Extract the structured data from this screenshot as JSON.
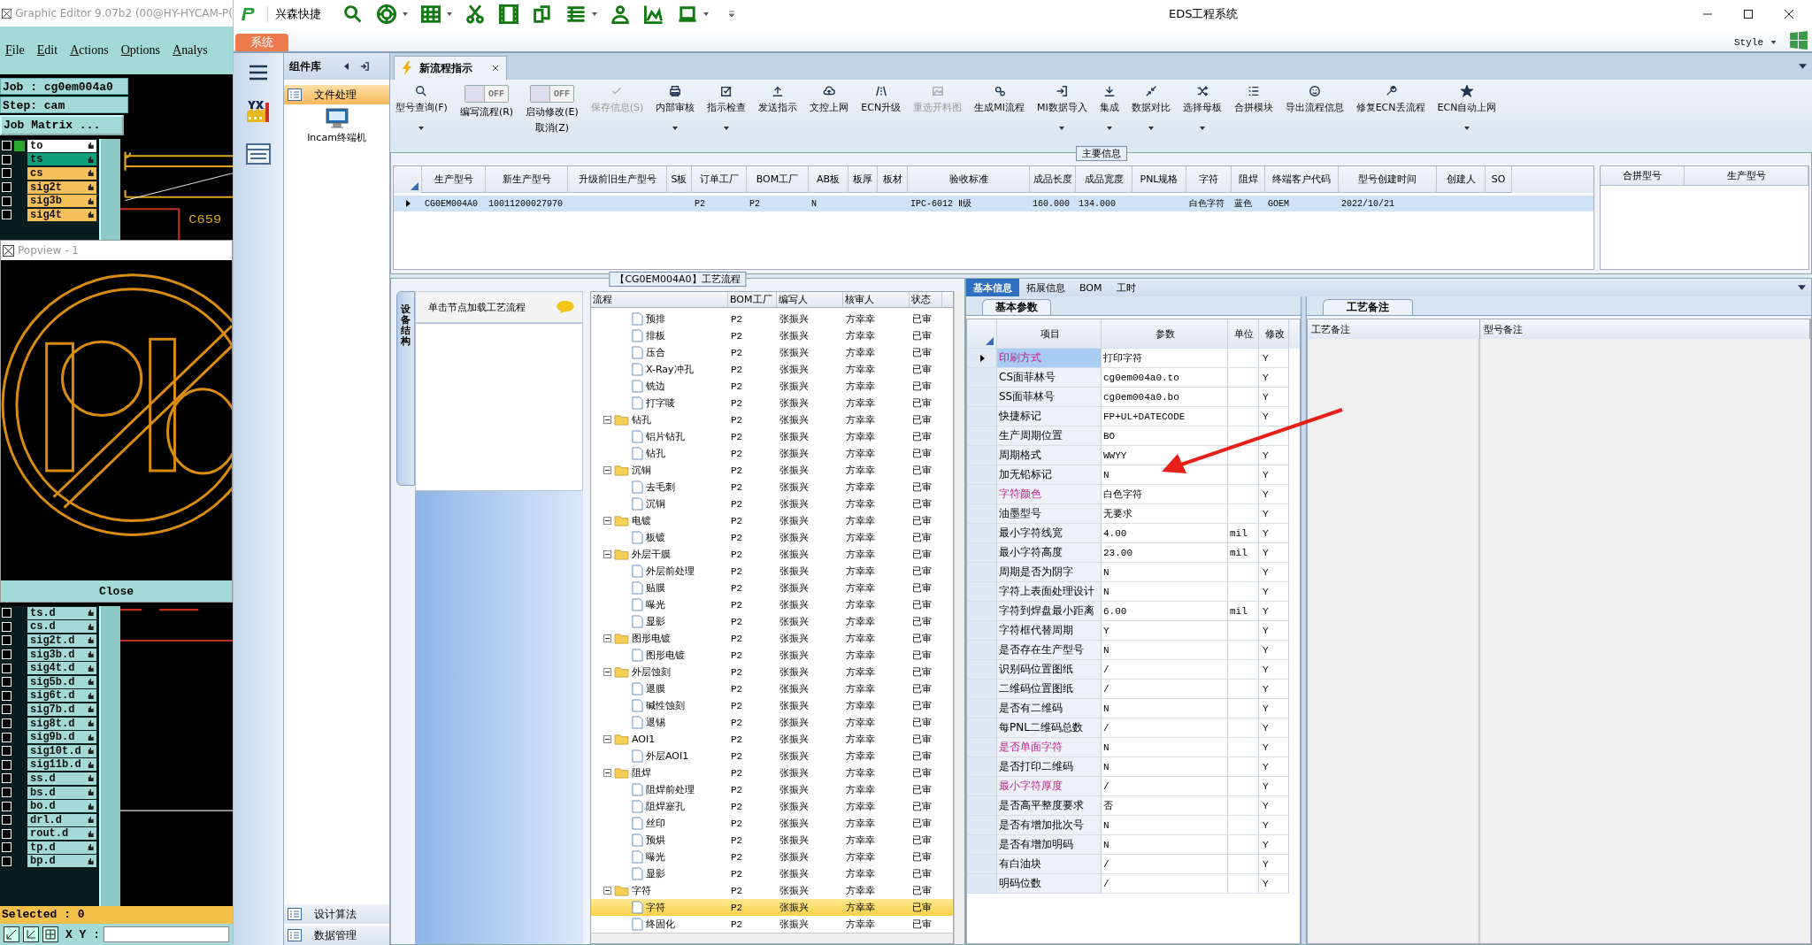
{
  "graphic_editor": {
    "title": "Graphic Editor 9.07b2 (00@HY-HYCAM-P(",
    "menu": [
      "File",
      "Edit",
      "Actions",
      "Options",
      "Analys"
    ],
    "job": "Job : cg0em004a0",
    "step": "Step: cam",
    "job_matrix_button": "Job Matrix ...",
    "canvas_label": "C659",
    "layers_top": [
      {
        "name": "to",
        "color": "#ffffff",
        "affected": true,
        "checked": false
      },
      {
        "name": "ts",
        "color": "#12a07c",
        "affected": false,
        "checked": false
      },
      {
        "name": "cs",
        "color": "#f6c05a",
        "affected": false,
        "checked": false
      },
      {
        "name": "sig2t",
        "color": "#f6c05a",
        "affected": false,
        "checked": false
      },
      {
        "name": "sig3b",
        "color": "#f6c05a",
        "affected": false,
        "checked": false
      },
      {
        "name": "sig4t",
        "color": "#f6c05a",
        "affected": false,
        "checked": false
      }
    ],
    "popview": {
      "title": "Popview - 1",
      "close_button": "Close"
    },
    "layers_bottom": [
      {
        "name": "ts.d",
        "checked": false
      },
      {
        "name": "cs.d",
        "checked": false
      },
      {
        "name": "sig2t.d",
        "checked": false
      },
      {
        "name": "sig3b.d",
        "checked": false
      },
      {
        "name": "sig4t.d",
        "checked": false
      },
      {
        "name": "sig5b.d",
        "checked": false
      },
      {
        "name": "sig6t.d",
        "checked": false
      },
      {
        "name": "sig7b.d",
        "checked": false
      },
      {
        "name": "sig8t.d",
        "checked": false
      },
      {
        "name": "sig9b.d",
        "checked": false
      },
      {
        "name": "sig10t.d",
        "checked": false
      },
      {
        "name": "sig11b.d",
        "checked": false
      },
      {
        "name": "ss.d",
        "checked": false
      },
      {
        "name": "bs.d",
        "checked": false
      },
      {
        "name": "bo.d",
        "checked": false
      },
      {
        "name": "drl.d",
        "checked": false
      },
      {
        "name": "rout.d",
        "checked": false
      },
      {
        "name": "tp.d",
        "checked": false
      },
      {
        "name": "bp.d",
        "checked": false
      }
    ],
    "selected_status": "Selected : 0",
    "coord_label": "X Y :"
  },
  "window": {
    "title": "EDS工程系统",
    "quick_bar_label": "兴森快捷",
    "system_tab": "系统",
    "style_menu": "Style"
  },
  "component_library": {
    "title": "组件库",
    "items": [
      {
        "label": "文件处理",
        "selected": true
      }
    ],
    "tool": "Incam终端机",
    "bottom_items": [
      "设计算法",
      "数据管理"
    ]
  },
  "document_tab": {
    "label": "新流程指示"
  },
  "ribbon": [
    {
      "kind": "button",
      "label": "型号查询(F)",
      "dropdown": true,
      "disabled": false
    },
    {
      "kind": "toggle",
      "label": "编写流程(R)",
      "switch_text": "OFF",
      "on": false
    },
    {
      "kind": "toggle",
      "label": "启动修改(E)",
      "label_2": "取消(Z)",
      "switch_text": "OFF",
      "on": false
    },
    {
      "kind": "button",
      "label": "保存信息(S)",
      "dropdown": false,
      "disabled": true
    },
    {
      "kind": "button",
      "label": "内部审核",
      "dropdown": true,
      "disabled": false
    },
    {
      "kind": "button",
      "label": "指示检查",
      "dropdown": true,
      "disabled": false
    },
    {
      "kind": "button",
      "label": "发送指示",
      "dropdown": false,
      "disabled": false
    },
    {
      "kind": "button",
      "label": "文控上网",
      "dropdown": false,
      "disabled": false
    },
    {
      "kind": "button",
      "label": "ECN升级",
      "dropdown": false,
      "disabled": false
    },
    {
      "kind": "button",
      "label": "重选开料图",
      "dropdown": false,
      "disabled": true
    },
    {
      "kind": "button",
      "label": "生成MI流程",
      "dropdown": false,
      "disabled": false
    },
    {
      "kind": "button",
      "label": "MI数据导入",
      "dropdown": true,
      "disabled": false
    },
    {
      "kind": "button",
      "label": "集成",
      "dropdown": true,
      "disabled": false
    },
    {
      "kind": "button",
      "label": "数据对比",
      "dropdown": true,
      "disabled": false
    },
    {
      "kind": "button",
      "label": "选择母板",
      "dropdown": true,
      "disabled": false
    },
    {
      "kind": "button",
      "label": "合拼模块",
      "dropdown": false,
      "disabled": false
    },
    {
      "kind": "button",
      "label": "导出流程信息",
      "dropdown": false,
      "disabled": false
    },
    {
      "kind": "button",
      "label": "修复ECN丢流程",
      "dropdown": false,
      "disabled": false
    },
    {
      "kind": "button",
      "label": "ECN自动上网",
      "dropdown": true,
      "disabled": false
    }
  ],
  "main_info": {
    "title": "主要信息",
    "columns": [
      "生产型号",
      "新生产型号",
      "升级前旧生产型号",
      "S板",
      "订单工厂",
      "BOM工厂",
      "AB板",
      "板厚",
      "板材",
      "验收标准",
      "成品长度",
      "成品宽度",
      "PNL规格",
      "字符",
      "阻焊",
      "终端客户代码",
      "型号创建时间",
      "创建人",
      "SO"
    ],
    "rows": [
      {
        "selected": true,
        "cells": [
          "CG0EM004A0",
          "10011200027970",
          null,
          null,
          "P2",
          "P2",
          "N",
          null,
          null,
          "IPC-6012 Ⅱ级",
          "160.000",
          "134.000",
          null,
          "白色字符",
          "蓝色",
          "GOEM",
          "2022/10/21",
          null,
          null
        ]
      }
    ],
    "side_columns": [
      "合拼型号",
      "生产型号"
    ]
  },
  "process_flow": {
    "title": "【CG0EM004A0】工艺流程",
    "side_tab": "设备结构",
    "hint": "单击节点加载工艺流程",
    "columns": [
      "流程",
      "BOM工厂",
      "编写人",
      "核审人",
      "状态"
    ],
    "rows": [
      {
        "kind": "leaf",
        "name": "预排",
        "bom": "P2",
        "writer": "张振兴",
        "reviewer": "方幸幸",
        "status": "已审",
        "selected": false
      },
      {
        "kind": "leaf",
        "name": "排板",
        "bom": "P2",
        "writer": "张振兴",
        "reviewer": "方幸幸",
        "status": "已审",
        "selected": false
      },
      {
        "kind": "leaf",
        "name": "压合",
        "bom": "P2",
        "writer": "张振兴",
        "reviewer": "方幸幸",
        "status": "已审",
        "selected": false
      },
      {
        "kind": "leaf",
        "name": "X-Ray冲孔",
        "bom": "P2",
        "writer": "张振兴",
        "reviewer": "方幸幸",
        "status": "已审",
        "selected": false
      },
      {
        "kind": "leaf",
        "name": "铣边",
        "bom": "P2",
        "writer": "张振兴",
        "reviewer": "方幸幸",
        "status": "已审",
        "selected": false
      },
      {
        "kind": "leaf",
        "name": "打字唛",
        "bom": "P2",
        "writer": "张振兴",
        "reviewer": "方幸幸",
        "status": "已审",
        "selected": false
      },
      {
        "kind": "folder",
        "name": "钻孔",
        "bom": "P2",
        "writer": "张振兴",
        "reviewer": "方幸幸",
        "status": "已审",
        "selected": false,
        "expanded": true,
        "children": [
          {
            "kind": "leaf",
            "name": "铝片钻孔",
            "bom": "P2",
            "writer": "张振兴",
            "reviewer": "方幸幸",
            "status": "已审",
            "selected": false
          },
          {
            "kind": "leaf",
            "name": "钻孔",
            "bom": "P2",
            "writer": "张振兴",
            "reviewer": "方幸幸",
            "status": "已审",
            "selected": false
          }
        ]
      },
      {
        "kind": "folder",
        "name": "沉铜",
        "bom": "P2",
        "writer": "张振兴",
        "reviewer": "方幸幸",
        "status": "已审",
        "selected": false,
        "expanded": true,
        "children": [
          {
            "kind": "leaf",
            "name": "去毛刺",
            "bom": "P2",
            "writer": "张振兴",
            "reviewer": "方幸幸",
            "status": "已审",
            "selected": false
          },
          {
            "kind": "leaf",
            "name": "沉铜",
            "bom": "P2",
            "writer": "张振兴",
            "reviewer": "方幸幸",
            "status": "已审",
            "selected": false
          }
        ]
      },
      {
        "kind": "folder",
        "name": "电镀",
        "bom": "P2",
        "writer": "张振兴",
        "reviewer": "方幸幸",
        "status": "已审",
        "selected": false,
        "expanded": true,
        "children": [
          {
            "kind": "leaf",
            "name": "板镀",
            "bom": "P2",
            "writer": "张振兴",
            "reviewer": "方幸幸",
            "status": "已审",
            "selected": false
          }
        ]
      },
      {
        "kind": "folder",
        "name": "外层干膜",
        "bom": "P2",
        "writer": "张振兴",
        "reviewer": "方幸幸",
        "status": "已审",
        "selected": false,
        "expanded": true,
        "children": [
          {
            "kind": "leaf",
            "name": "外层前处理",
            "bom": "P2",
            "writer": "张振兴",
            "reviewer": "方幸幸",
            "status": "已审",
            "selected": false
          },
          {
            "kind": "leaf",
            "name": "贴膜",
            "bom": "P2",
            "writer": "张振兴",
            "reviewer": "方幸幸",
            "status": "已审",
            "selected": false
          },
          {
            "kind": "leaf",
            "name": "曝光",
            "bom": "P2",
            "writer": "张振兴",
            "reviewer": "方幸幸",
            "status": "已审",
            "selected": false
          },
          {
            "kind": "leaf",
            "name": "显影",
            "bom": "P2",
            "writer": "张振兴",
            "reviewer": "方幸幸",
            "status": "已审",
            "selected": false
          }
        ]
      },
      {
        "kind": "folder",
        "name": "图形电镀",
        "bom": "P2",
        "writer": "张振兴",
        "reviewer": "方幸幸",
        "status": "已审",
        "selected": false,
        "expanded": true,
        "children": [
          {
            "kind": "leaf",
            "name": "图形电镀",
            "bom": "P2",
            "writer": "张振兴",
            "reviewer": "方幸幸",
            "status": "已审",
            "selected": false
          }
        ]
      },
      {
        "kind": "folder",
        "name": "外层蚀刻",
        "bom": "P2",
        "writer": "张振兴",
        "reviewer": "方幸幸",
        "status": "已审",
        "selected": false,
        "expanded": true,
        "children": [
          {
            "kind": "leaf",
            "name": "退膜",
            "bom": "P2",
            "writer": "张振兴",
            "reviewer": "方幸幸",
            "status": "已审",
            "selected": false
          },
          {
            "kind": "leaf",
            "name": "碱性蚀刻",
            "bom": "P2",
            "writer": "张振兴",
            "reviewer": "方幸幸",
            "status": "已审",
            "selected": false
          },
          {
            "kind": "leaf",
            "name": "退锡",
            "bom": "P2",
            "writer": "张振兴",
            "reviewer": "方幸幸",
            "status": "已审",
            "selected": false
          }
        ]
      },
      {
        "kind": "folder",
        "name": "AOI1",
        "bom": "P2",
        "writer": "张振兴",
        "reviewer": "方幸幸",
        "status": "已审",
        "selected": false,
        "expanded": true,
        "children": [
          {
            "kind": "leaf",
            "name": "外层AOI1",
            "bom": "P2",
            "writer": "张振兴",
            "reviewer": "方幸幸",
            "status": "已审",
            "selected": false
          }
        ]
      },
      {
        "kind": "folder",
        "name": "阻焊",
        "bom": "P2",
        "writer": "张振兴",
        "reviewer": "方幸幸",
        "status": "已审",
        "selected": false,
        "expanded": true,
        "children": [
          {
            "kind": "leaf",
            "name": "阻焊前处理",
            "bom": "P2",
            "writer": "张振兴",
            "reviewer": "方幸幸",
            "status": "已审",
            "selected": false
          },
          {
            "kind": "leaf",
            "name": "阻焊塞孔",
            "bom": "P2",
            "writer": "张振兴",
            "reviewer": "方幸幸",
            "status": "已审",
            "selected": false
          },
          {
            "kind": "leaf",
            "name": "丝印",
            "bom": "P2",
            "writer": "张振兴",
            "reviewer": "方幸幸",
            "status": "已审",
            "selected": false
          },
          {
            "kind": "leaf",
            "name": "预烘",
            "bom": "P2",
            "writer": "张振兴",
            "reviewer": "方幸幸",
            "status": "已审",
            "selected": false
          },
          {
            "kind": "leaf",
            "name": "曝光",
            "bom": "P2",
            "writer": "张振兴",
            "reviewer": "方幸幸",
            "status": "已审",
            "selected": false
          },
          {
            "kind": "leaf",
            "name": "显影",
            "bom": "P2",
            "writer": "张振兴",
            "reviewer": "方幸幸",
            "status": "已审",
            "selected": false
          }
        ]
      },
      {
        "kind": "folder",
        "name": "字符",
        "bom": "P2",
        "writer": "张振兴",
        "reviewer": "方幸幸",
        "status": "已审",
        "selected": false,
        "expanded": true,
        "children": [
          {
            "kind": "leaf",
            "name": "字符",
            "bom": "P2",
            "writer": "张振兴",
            "reviewer": "方幸幸",
            "status": "已审",
            "selected": true
          },
          {
            "kind": "leaf",
            "name": "终固化",
            "bom": "P2",
            "writer": "张振兴",
            "reviewer": "方幸幸",
            "status": "已审",
            "selected": false
          }
        ]
      }
    ]
  },
  "detail_tabs": [
    {
      "label": "基本信息",
      "selected": true
    },
    {
      "label": "拓展信息",
      "selected": false
    },
    {
      "label": "BOM",
      "selected": false
    },
    {
      "label": "工时",
      "selected": false
    }
  ],
  "basic_params": {
    "tab": "基本参数",
    "columns": [
      "项目",
      "参数",
      "单位",
      "修改"
    ],
    "rows": [
      {
        "item": "印刷方式",
        "value": "打印字符",
        "modified": "Y",
        "highlighted": true,
        "selected": true
      },
      {
        "item": "CS面菲林号",
        "value": "cg0em004a0.to",
        "modified": "Y",
        "highlighted": false,
        "selected": false
      },
      {
        "item": "SS面菲林号",
        "value": "cg0em004a0.bo",
        "modified": "Y",
        "highlighted": false,
        "selected": false
      },
      {
        "item": "快捷标记",
        "value": "FP+UL+DATECODE",
        "modified": "Y",
        "highlighted": false,
        "selected": false
      },
      {
        "item": "生产周期位置",
        "value": "BO",
        "highlighted": false,
        "selected": false
      },
      {
        "item": "周期格式",
        "value": "WWYY",
        "modified": "Y",
        "highlighted": false,
        "selected": false
      },
      {
        "item": "加无铅标记",
        "value": "N",
        "modified": "Y",
        "highlighted": false,
        "selected": false
      },
      {
        "item": "字符颜色",
        "value": "白色字符",
        "modified": "Y",
        "highlighted": true,
        "selected": false
      },
      {
        "item": "油墨型号",
        "value": "无要求",
        "modified": "Y",
        "highlighted": false,
        "selected": false
      },
      {
        "item": "最小字符线宽",
        "value": "4.00",
        "unit": "mil",
        "modified": "Y",
        "highlighted": false,
        "selected": false
      },
      {
        "item": "最小字符高度",
        "value": "23.00",
        "unit": "mil",
        "modified": "Y",
        "highlighted": false,
        "selected": false
      },
      {
        "item": "周期是否为阴字",
        "value": "N",
        "modified": "Y",
        "highlighted": false,
        "selected": false
      },
      {
        "item": "字符上表面处理设计",
        "value": "N",
        "modified": "Y",
        "highlighted": false,
        "selected": false
      },
      {
        "item": "字符到焊盘最小距离",
        "value": "6.00",
        "unit": "mil",
        "modified": "Y",
        "highlighted": false,
        "selected": false
      },
      {
        "item": "字符框代替周期",
        "value": "Y",
        "modified": "Y",
        "highlighted": false,
        "selected": false
      },
      {
        "item": "是否存在生产型号",
        "value": "N",
        "modified": "Y",
        "highlighted": false,
        "selected": false
      },
      {
        "item": "识别码位置图纸",
        "value": "/",
        "modified": "Y",
        "highlighted": false,
        "selected": false
      },
      {
        "item": "二维码位置图纸",
        "value": "/",
        "modified": "Y",
        "highlighted": false,
        "selected": false
      },
      {
        "item": "是否有二维码",
        "value": "N",
        "modified": "Y",
        "highlighted": false,
        "selected": false
      },
      {
        "item": "每PNL二维码总数",
        "value": "/",
        "modified": "Y",
        "highlighted": false,
        "selected": false
      },
      {
        "item": "是否单面字符",
        "value": "N",
        "modified": "Y",
        "highlighted": true,
        "selected": false
      },
      {
        "item": "是否打印二维码",
        "value": "N",
        "modified": "Y",
        "highlighted": false,
        "selected": false
      },
      {
        "item": "最小字符厚度",
        "value": "/",
        "modified": "Y",
        "highlighted": true,
        "selected": false
      },
      {
        "item": "是否高平整度要求",
        "value": "否",
        "modified": "Y",
        "highlighted": false,
        "selected": false
      },
      {
        "item": "是否有增加批次号",
        "value": "N",
        "modified": "Y",
        "highlighted": false,
        "selected": false
      },
      {
        "item": "是否有增加明码",
        "value": "N",
        "modified": "Y",
        "highlighted": false,
        "selected": false
      },
      {
        "item": "有白油块",
        "value": "/",
        "modified": "Y",
        "highlighted": false,
        "selected": false
      },
      {
        "item": "明码位数",
        "value": "/",
        "modified": "Y",
        "highlighted": false,
        "selected": false
      }
    ]
  },
  "remarks": {
    "tab": "工艺备注",
    "columns": [
      "工艺备注",
      "型号备注"
    ]
  }
}
